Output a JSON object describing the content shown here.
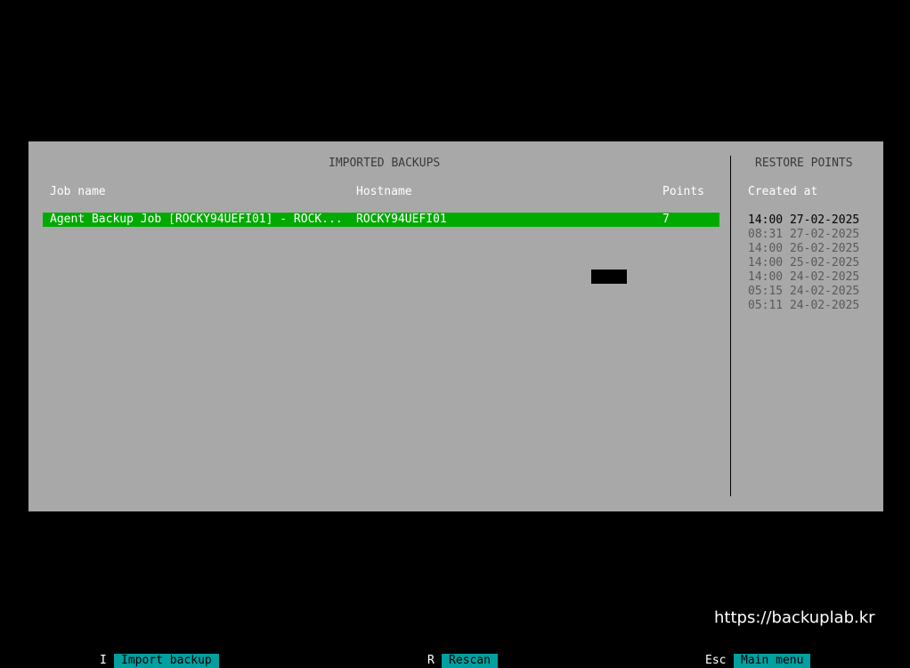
{
  "imported_backups": {
    "title": "IMPORTED BACKUPS",
    "columns": {
      "job_name": "Job name",
      "hostname": "Hostname",
      "points": "Points"
    },
    "rows": [
      {
        "job_name": "Agent Backup Job [ROCKY94UEFI01] - ROCK...",
        "hostname": "ROCKY94UEFI01",
        "points": "7",
        "selected": true
      }
    ]
  },
  "restore_points": {
    "title": "RESTORE POINTS",
    "column": "Created at",
    "items": [
      "14:00 27-02-2025",
      "08:31 27-02-2025",
      "14:00 26-02-2025",
      "14:00 25-02-2025",
      "14:00 24-02-2025",
      "05:15 24-02-2025",
      "05:11 24-02-2025"
    ]
  },
  "watermark": "https://backuplab.kr",
  "footer": {
    "import": {
      "key": "I",
      "label": "Import backup"
    },
    "rescan": {
      "key": "R",
      "label": "Rescan"
    },
    "menu": {
      "key": "Esc",
      "label": "Main menu"
    }
  },
  "colors": {
    "panel_bg": "#a8a8a8",
    "selection_bg": "#00aa00",
    "footer_label_bg": "#00a0a0",
    "screen_bg": "#000000"
  }
}
